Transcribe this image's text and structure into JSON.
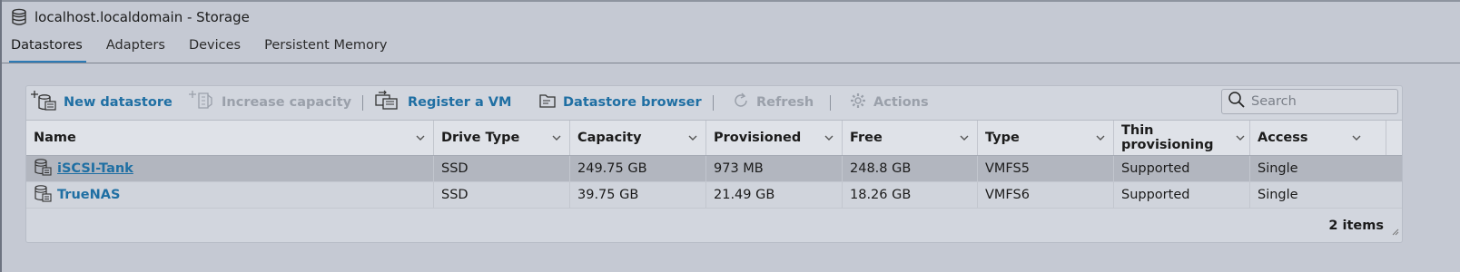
{
  "window": {
    "title": "localhost.localdomain - Storage"
  },
  "tabs": [
    {
      "label": "Datastores",
      "active": true
    },
    {
      "label": "Adapters",
      "active": false
    },
    {
      "label": "Devices",
      "active": false
    },
    {
      "label": "Persistent Memory",
      "active": false
    }
  ],
  "toolbar": {
    "new_datastore": "New datastore",
    "increase_capacity": "Increase capacity",
    "register_vm": "Register a VM",
    "datastore_browser": "Datastore browser",
    "refresh": "Refresh",
    "actions": "Actions"
  },
  "search": {
    "placeholder": "Search"
  },
  "table": {
    "columns": [
      "Name",
      "Drive Type",
      "Capacity",
      "Provisioned",
      "Free",
      "Type",
      "Thin provisioning",
      "Access"
    ],
    "rows": [
      {
        "name": "iSCSI-Tank",
        "drive_type": "SSD",
        "capacity": "249.75 GB",
        "provisioned": "973 MB",
        "free": "248.8 GB",
        "type": "VMFS5",
        "thin": "Supported",
        "access": "Single",
        "selected": true
      },
      {
        "name": "TrueNAS",
        "drive_type": "SSD",
        "capacity": "39.75 GB",
        "provisioned": "21.49 GB",
        "free": "18.26 GB",
        "type": "VMFS6",
        "thin": "Supported",
        "access": "Single",
        "selected": false
      }
    ],
    "footer": "2 items"
  },
  "colors": {
    "accent": "#2e7bb5",
    "link": "#1f6fa3",
    "disabled": "#9aa0aa",
    "background": "#c5c9d3"
  }
}
